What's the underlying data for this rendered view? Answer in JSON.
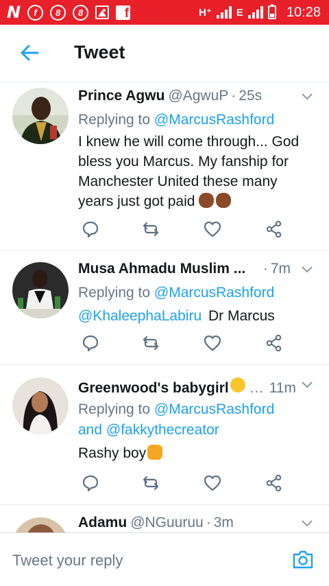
{
  "status_bar": {
    "network_label": "H⁺",
    "network2_label": "E",
    "time": "10:28",
    "app_icon_labels": [
      "N",
      "f",
      "8",
      "8",
      "f"
    ]
  },
  "header": {
    "title": "Tweet"
  },
  "tweets": [
    {
      "name": "Prince Agwu",
      "handle": "@AgwuP",
      "time": "25s",
      "replying_prefix": "Replying to ",
      "replying_to": "@MarcusRashford",
      "replying_extra_prefix": "",
      "replying_extra": "",
      "mention": "",
      "text_lines": [
        "I knew he will come through... God",
        "bless you Marcus. My fanship for",
        "Manchester United these many",
        "years just got paid"
      ],
      "emoji": "fist-bump-emoji"
    },
    {
      "name": "Musa Ahmadu  Muslim ...",
      "handle": "",
      "time": "7m",
      "replying_prefix": "Replying to ",
      "replying_to": "@MarcusRashford",
      "replying_extra_prefix": "",
      "replying_extra": "",
      "mention": "@KhaleephaLabiru",
      "text_lines": [
        "Dr Marcus"
      ],
      "emoji": ""
    },
    {
      "name": "Greenwood's babygirl",
      "handle": "",
      "time": "11m",
      "replying_prefix": "Replying to ",
      "replying_to": "@MarcusRashford",
      "replying_extra_prefix": "and ",
      "replying_extra": "@fakkythecreator",
      "mention": "",
      "text_lines": [
        "Rashy boy"
      ],
      "emoji": "heart-eyes-cat-emoji"
    },
    {
      "name": "Adamu",
      "handle": "@NGuuruu",
      "time": "3m",
      "replying_prefix": "",
      "replying_to": "",
      "replying_extra_prefix": "",
      "replying_extra": "",
      "mention": "",
      "text_lines": [],
      "emoji": ""
    }
  ],
  "reply_bar": {
    "placeholder": "Tweet your reply"
  },
  "colors": {
    "status_bar": "#e8202a",
    "accent": "#1da1f2",
    "muted": "#657786",
    "icon": "#5b7083",
    "divider": "#e6ecf0"
  },
  "icons": [
    "back-arrow-icon",
    "caret-down-icon",
    "reply-icon",
    "retweet-icon",
    "like-icon",
    "share-icon",
    "camera-icon"
  ]
}
